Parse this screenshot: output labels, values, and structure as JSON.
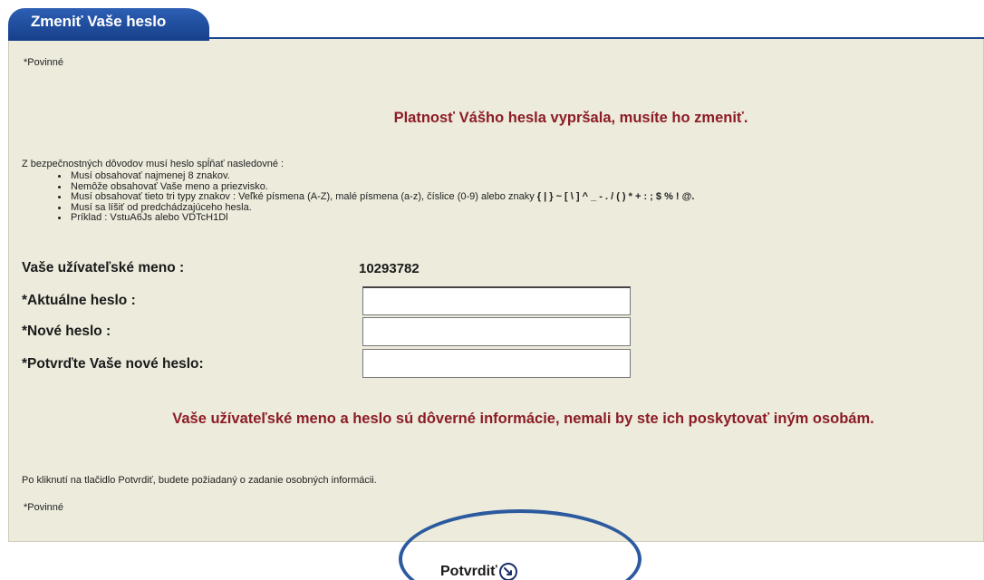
{
  "tab": {
    "title": "Zmeniť Vaše heslo"
  },
  "required_note_top": "*Povinné",
  "expired_message": "Platnosť Vášho hesla vypršala, musíte ho zmeniť.",
  "rules": {
    "intro": "Z bezpečnostných dôvodov musí heslo spĺňať nasledovné :",
    "items": [
      "Musí obsahovať najmenej 8 znakov.",
      "Nemôže obsahovať Vaše meno a priezvisko.",
      "Musí obsahovať tieto tri typy znakov : Veľké písmena (A-Z), malé písmena (a-z), číslice (0-9) alebo znaky ",
      "Musí sa líšiť od predchádzajúceho hesla.",
      "Príklad : VstuA6Js alebo VDTcH1Dl"
    ],
    "special_chars": "{ | } ~ [ \\ ] ^ _ - . / ( ) * + : ; $ % ! @."
  },
  "form": {
    "username_label": "Vaše užívateľské meno :",
    "username_value": "10293782",
    "current_password_label": "*Aktuálne heslo :",
    "new_password_label": "*Nové heslo :",
    "confirm_password_label": "*Potvrďte Vaše nové heslo:",
    "current_password_value": "",
    "new_password_value": "",
    "confirm_password_value": ""
  },
  "confidential_message": "Vaše užívateľské meno a heslo sú dôverné informácie, nemali by ste ich poskytovať iným osobám.",
  "next_step_note": "Po kliknutí na tlačidlo Potvrdiť, budete požiadaný o zadanie osobných informácii.",
  "required_note_bottom": "*Povinné",
  "confirm_button": {
    "label": "Potvrdiť",
    "icon": "arrow-right-circle-icon"
  },
  "colors": {
    "tab_blue": "#1c468f",
    "panel_bg": "#ecebdc",
    "alert_red": "#8c1c26",
    "annotation_blue": "#2c5a9e"
  }
}
